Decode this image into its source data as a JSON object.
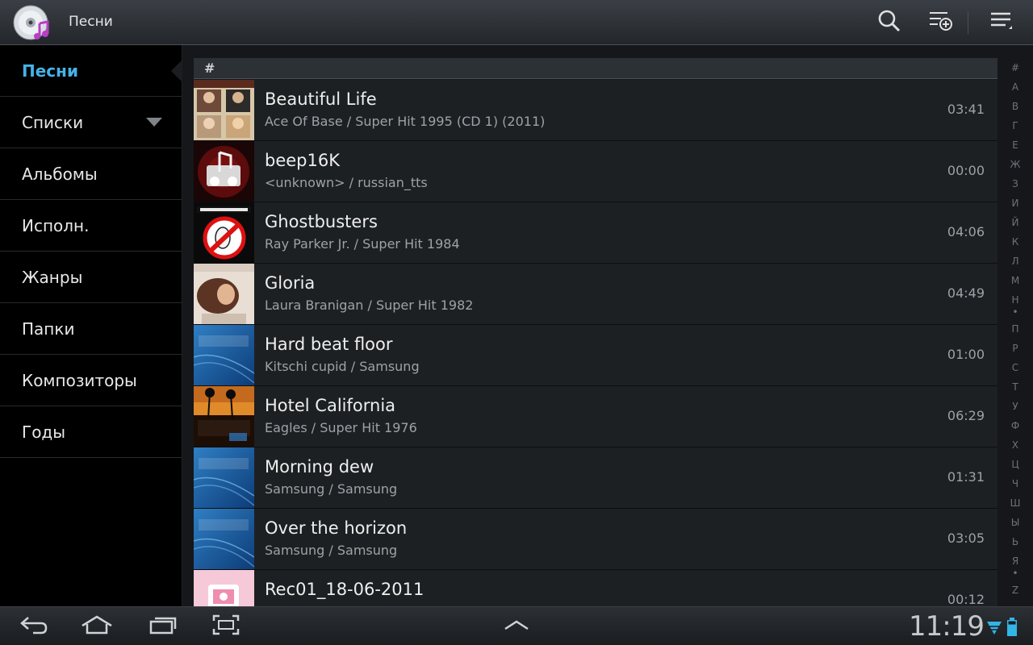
{
  "actionbar": {
    "title": "Песни",
    "icons": [
      "music-app-icon",
      "search-icon",
      "add-to-playlist-icon",
      "menu-icon"
    ]
  },
  "sidebar": {
    "items": [
      {
        "label": "Песни",
        "active": true
      },
      {
        "label": "Списки",
        "dropdown": true
      },
      {
        "label": "Альбомы"
      },
      {
        "label": "Исполн."
      },
      {
        "label": "Жанры"
      },
      {
        "label": "Папки"
      },
      {
        "label": "Композиторы"
      },
      {
        "label": "Годы"
      }
    ]
  },
  "list": {
    "section_header": "#",
    "songs": [
      {
        "title": "Beautiful Life",
        "subtitle": "Ace Of Base / Super Hit 1995 (CD 1) (2011)",
        "duration": "03:41",
        "art": "ace-of-base-cover"
      },
      {
        "title": "beep16K",
        "subtitle": "<unknown> / russian_tts",
        "duration": "00:00",
        "art": "default-music-cover"
      },
      {
        "title": "Ghostbusters",
        "subtitle": "Ray Parker Jr. / Super Hit 1984",
        "duration": "04:06",
        "art": "ghostbusters-cover"
      },
      {
        "title": "Gloria",
        "subtitle": "Laura Branigan / Super Hit 1982",
        "duration": "04:49",
        "art": "laura-branigan-cover"
      },
      {
        "title": "Hard beat floor",
        "subtitle": "Kitschi cupid / Samsung",
        "duration": "01:00",
        "art": "samsung-cover"
      },
      {
        "title": "Hotel California",
        "subtitle": "Eagles / Super Hit 1976",
        "duration": "06:29",
        "art": "hotel-california-cover"
      },
      {
        "title": "Morning dew",
        "subtitle": "Samsung / Samsung",
        "duration": "01:31",
        "art": "samsung-cover"
      },
      {
        "title": "Over the horizon",
        "subtitle": "Samsung / Samsung",
        "duration": "03:05",
        "art": "samsung-cover"
      },
      {
        "title": "Rec01_18-06-2011",
        "subtitle": "",
        "duration": "00:12",
        "art": "pink-cover"
      }
    ]
  },
  "index_bar": [
    "#",
    "А",
    "В",
    "Г",
    "Е",
    "Ж",
    "З",
    "И",
    "Й",
    "К",
    "Л",
    "М",
    "Н",
    "•",
    "П",
    "Р",
    "С",
    "Т",
    "У",
    "Ф",
    "Х",
    "Ц",
    "Ч",
    "Ш",
    "Ы",
    "Ь",
    "Я",
    "•",
    "Z"
  ],
  "system_bar": {
    "clock": "11:19",
    "icons": [
      "back-icon",
      "home-icon",
      "recent-apps-icon",
      "screenshot-icon",
      "up-arrow-icon",
      "wifi-icon",
      "battery-icon"
    ]
  },
  "colors": {
    "accent": "#45b3e8",
    "background": "#000000",
    "row": "#1d2023"
  }
}
